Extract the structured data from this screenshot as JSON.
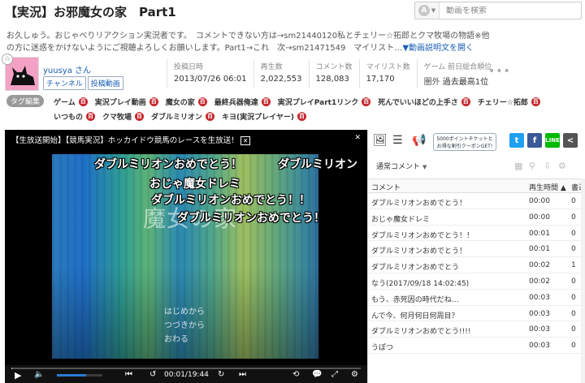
{
  "title": "【実況】お邪魔女の家　Part1",
  "search": {
    "mode_icon": "A",
    "placeholder": "動画を検索"
  },
  "description": {
    "line1": "お久しゅう。おじゃべりリアクション実況者です。　コメントできない方は→sm21440120私とチェリー☆拓郎とクマ牧場の物語※他",
    "line2": "の方に迷惑をかけないようにご視聴よろしくお願いします。Part1→これ　次→sm21471549　マイリスト…",
    "more": "▼動画説明文を開く"
  },
  "uploader": {
    "name": "yuusya さん",
    "tags": [
      "チャンネル",
      "投稿動画"
    ]
  },
  "stats": [
    {
      "label": "投稿日時",
      "value": "2013/07/26 06:01"
    },
    {
      "label": "再生数",
      "value": "2,022,553"
    },
    {
      "label": "コメント数",
      "value": "128,083"
    },
    {
      "label": "マイリスト数",
      "value": "17,170"
    }
  ],
  "rank": {
    "label": "ゲーム 前日総合順位",
    "prefix": "圏外",
    "value": "過去最高1位"
  },
  "tag_edit": "タグ編集",
  "tags": [
    "ゲーム",
    "実況プレイ動画",
    "魔女の家",
    "最終兵器俺達",
    "実況プレイPart1リンク",
    "死んでいいほどの上手さ",
    "チェリー☆拓郎",
    "いつもの",
    "クマ牧場",
    "ダブルミリオン",
    "キヨ(実況プレイヤー)"
  ],
  "tag_dic": "百",
  "player": {
    "title": "【生放送開始】【競馬実況】ホッカイドウ競馬のレースを生放送！",
    "title_x": "✕",
    "logo": "魔女の家",
    "menu": [
      "はじめから",
      "つづきから",
      "おわる"
    ],
    "comments": [
      "ダブルミリオンおめでとう！",
      "ダブルミリオン",
      "おじゃ魔女ドレミ",
      "ダブルミリオンおめでとう！！",
      "ダブルミリオンおめでとう！"
    ],
    "time": "00:01/19:44",
    "seek_progress": 0.001,
    "volume": 0.65
  },
  "panel": {
    "nicoad": [
      "5000ポイントチケットと",
      "お得な割引クーポンGET!"
    ],
    "comment_mode": "通常コメント",
    "headers": {
      "comment": "コメント",
      "time": "再生時間 ▲",
      "date": "書込"
    },
    "rows": [
      {
        "c": "ダブルミリオンおめでとう！",
        "t": "00:00",
        "d": "0"
      },
      {
        "c": "おじゃ魔女ドレミ",
        "t": "00:00",
        "d": "0"
      },
      {
        "c": "ダブルミリオンおめでとう！！",
        "t": "00:01",
        "d": "0"
      },
      {
        "c": "ダブルミリオンおめでとう！",
        "t": "00:01",
        "d": "0"
      },
      {
        "c": "ダブルミリオンおめでとう",
        "t": "00:02",
        "d": "1"
      },
      {
        "c": "なう(2017/09/18 14:02:45)",
        "t": "00:02",
        "d": "0"
      },
      {
        "c": "もう、赤死因の時代だね…",
        "t": "00:03",
        "d": "0"
      },
      {
        "c": "んで今、何月何日何周目？",
        "t": "00:03",
        "d": "0"
      },
      {
        "c": "ダブルミリオンおめでとう!!!!",
        "t": "00:03",
        "d": "0"
      },
      {
        "c": "うぽつ",
        "t": "00:03",
        "d": "0"
      }
    ]
  },
  "colors": {
    "link": "#1a5fb4",
    "dic_badge": "#c5262c",
    "twitter": "#1da1f2",
    "facebook": "#3b5998",
    "line": "#00b900",
    "share": "#555555"
  }
}
